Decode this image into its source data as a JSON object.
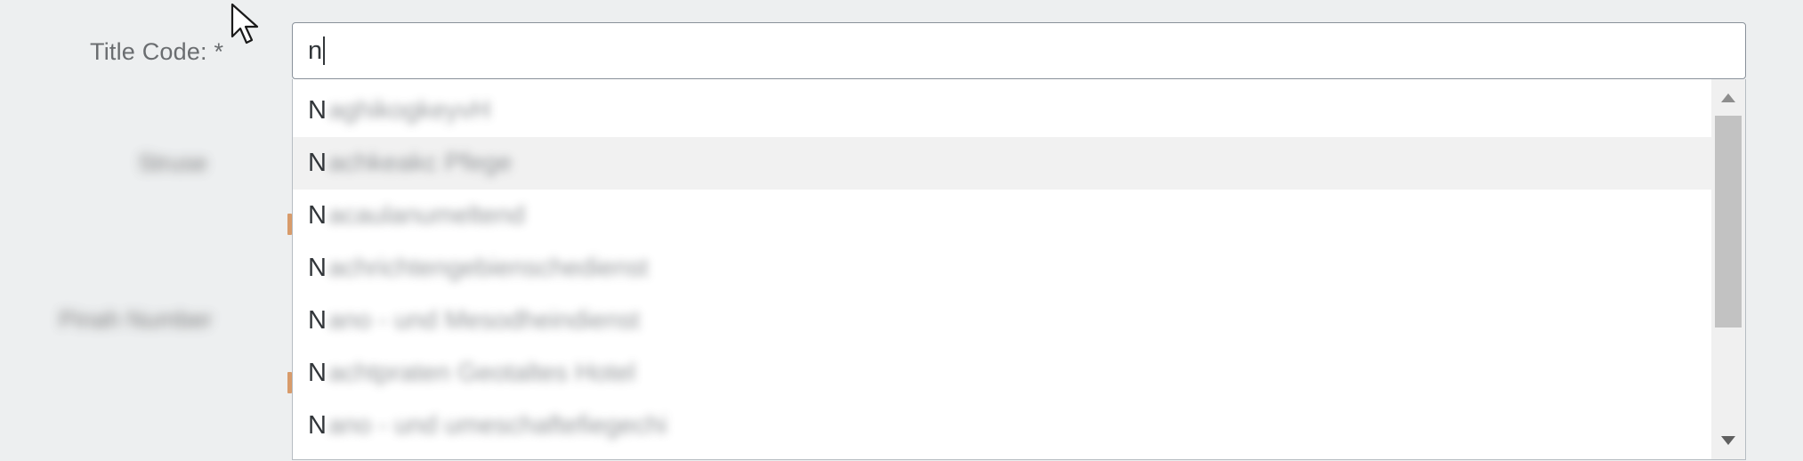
{
  "form": {
    "title_code_label": "Title Code: *",
    "blurred_label_1": "Struse",
    "blurred_label_2": "Pinah Number"
  },
  "title_code_input": {
    "value": "n"
  },
  "dropdown": {
    "items": [
      {
        "first": "N",
        "rest": "aghikogkeyvH"
      },
      {
        "first": "N",
        "rest": "achkeakc Pfege"
      },
      {
        "first": "N",
        "rest": "acaulanumeltend"
      },
      {
        "first": "N",
        "rest": "achrichtengebienschedienst"
      },
      {
        "first": "N",
        "rest": "ano - und Mesodheindienst"
      },
      {
        "first": "N",
        "rest": "achtpraten Geotaltes Hotel"
      },
      {
        "first": "N",
        "rest": "ano - und umeschaftefiegechi"
      }
    ],
    "hover_index": 1
  },
  "icons": {
    "scroll_up": "scroll-up-arrow-icon",
    "scroll_down": "scroll-down-arrow-icon",
    "cursor": "mouse-pointer-icon"
  },
  "colors": {
    "background": "#edeff0",
    "label": "#6a6d70",
    "input_border": "#89919a",
    "required_marker": "#d89b6a"
  }
}
